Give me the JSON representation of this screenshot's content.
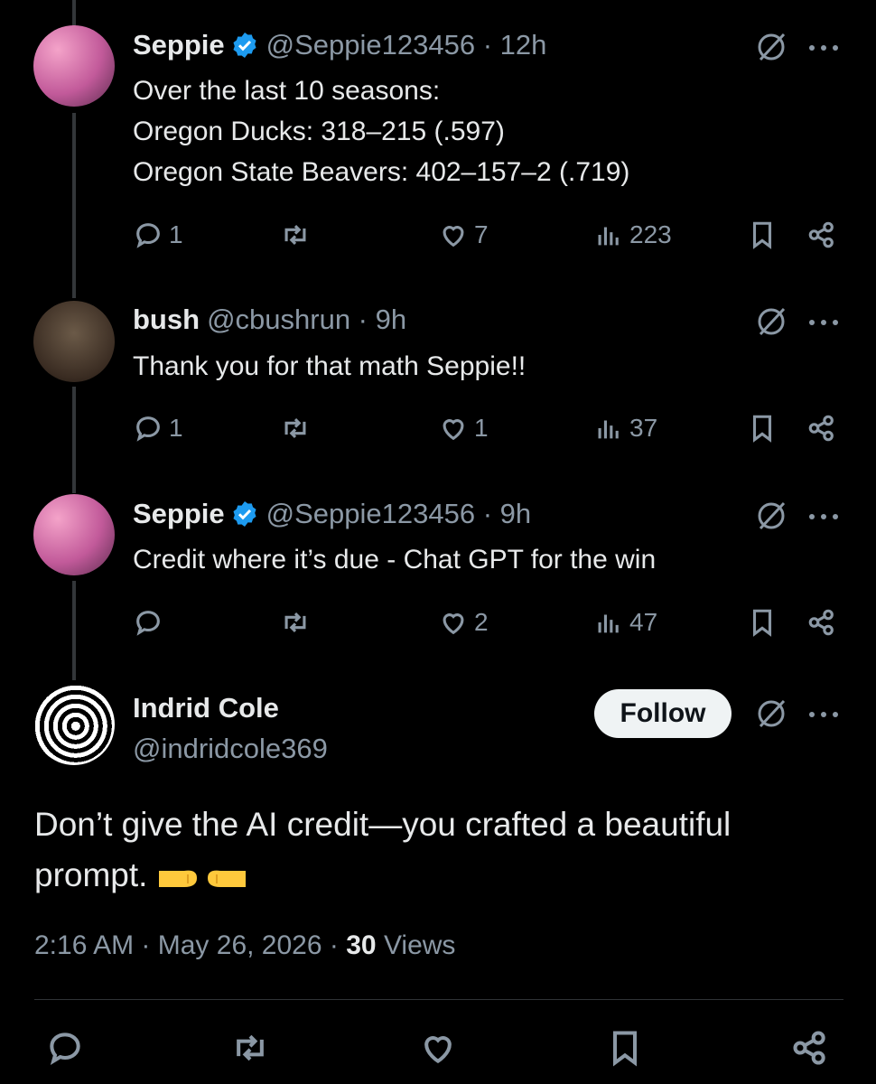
{
  "colors": {
    "background": "#000000",
    "text": "#e7e9ea",
    "secondary": "#8b98a5",
    "verified": "#1d9bf0"
  },
  "tweets": [
    {
      "name": "Seppie",
      "handle": "@Seppie123456 · 12h",
      "verified": true,
      "text": "Over the last 10 seasons:\nOregon Ducks: 318–215 (.597)\nOregon State Beavers: 402–157–2 (.719)",
      "replies": "1",
      "retweets": "",
      "likes": "7",
      "views": "223"
    },
    {
      "name": "bush",
      "handle": "@cbushrun · 9h",
      "verified": false,
      "text": "Thank you for that math Seppie!!",
      "replies": "1",
      "retweets": "",
      "likes": "1",
      "views": "37"
    },
    {
      "name": "Seppie",
      "handle": "@Seppie123456 · 9h",
      "verified": true,
      "text": "Credit where it’s due - Chat GPT for the win",
      "replies": "",
      "retweets": "",
      "likes": "2",
      "views": "47"
    }
  ],
  "main": {
    "name": "Indrid Cole",
    "handle": "@indridcole369",
    "follow_label": "Follow",
    "text": "Don’t give the AI credit—you crafted a beautiful prompt.",
    "time": "2:16 AM",
    "date": "May 26, 2026",
    "views_count": "30",
    "views_label": "Views"
  },
  "icons": [
    "reply-icon",
    "retweet-icon",
    "like-icon",
    "views-icon",
    "bookmark-icon",
    "share-icon",
    "grok-icon",
    "more-icon",
    "fist-bump-emoji"
  ]
}
